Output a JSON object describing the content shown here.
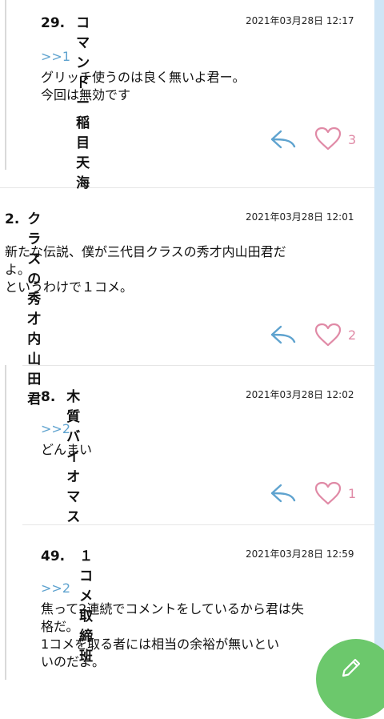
{
  "comments": [
    {
      "number": "29.",
      "author": "コマンドー稲目天海",
      "date": "2021年03月28日 12:17",
      "reply_to": ">>1",
      "lines": [
        "グリッチ使うのは良く無いよ君ー。",
        "今回は無効です"
      ],
      "likes": "3"
    },
    {
      "number": "2.",
      "author": "クラスの秀才内山田君",
      "date": "2021年03月28日 12:01",
      "reply_to": "",
      "lines": [
        "新たな伝説、僕が三代目クラスの秀才内山田君だ",
        "よ。",
        "というわけで１コメ。"
      ],
      "likes": "2"
    },
    {
      "number": "8.",
      "author": "木質バイオマス",
      "date": "2021年03月28日 12:02",
      "reply_to": ">>2",
      "lines": [
        "どんまい"
      ],
      "likes": "1"
    },
    {
      "number": "49.",
      "author": "１コメ取締班",
      "date": "2021年03月28日 12:59",
      "reply_to": ">>2",
      "lines": [
        "焦って2連続でコメントをしているから君は失",
        "格だ。",
        "1コメを取る者には相当の余裕が無いとい",
        "いのだよ。"
      ],
      "likes": ""
    }
  ],
  "icons": {
    "reply": "reply-arrow-icon",
    "like": "heart-icon",
    "compose": "pencil-icon"
  },
  "colors": {
    "accent_blue": "#5fa3cf",
    "like_pink": "#e08aa6",
    "fab_green": "#6cc86c",
    "rail_blue": "#cfe5f6"
  }
}
